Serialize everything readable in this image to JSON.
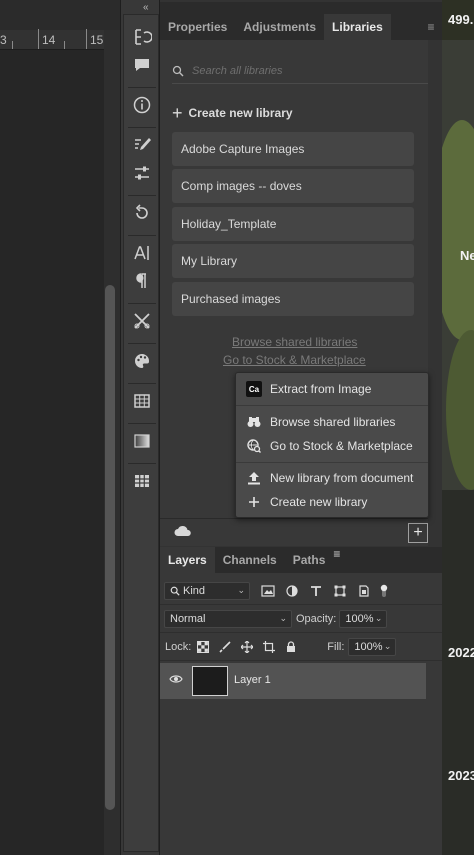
{
  "ruler": {
    "labels": [
      "3",
      "14",
      "15"
    ]
  },
  "properties_panel": {
    "tabs": [
      "Properties",
      "Adjustments",
      "Libraries"
    ],
    "active_tab": "Libraries"
  },
  "libraries": {
    "search_placeholder": "Search all libraries",
    "create_new_label": "Create new library",
    "items": [
      "Adobe Capture Images",
      "Comp images -- doves",
      "Holiday_Template",
      "My Library",
      "Purchased images"
    ],
    "browse_shared_link": "Browse shared libraries",
    "stock_link": "Go to Stock & Marketplace"
  },
  "popup_menu": {
    "ca_badge": "Ca",
    "items": [
      "Extract from Image",
      "Browse shared libraries",
      "Go to Stock & Marketplace",
      "New library from document",
      "Create new library"
    ]
  },
  "layers_panel": {
    "tabs": [
      "Layers",
      "Channels",
      "Paths"
    ],
    "active_tab": "Layers",
    "filter_kind": "Kind",
    "blend_mode": "Normal",
    "opacity_label": "Opacity:",
    "opacity_value": "100%",
    "lock_label": "Lock:",
    "fill_label": "Fill:",
    "fill_value": "100%",
    "layers": [
      {
        "name": "Layer 1",
        "visible": true
      }
    ]
  },
  "photo_strip": {
    "texts": [
      "499.",
      "Ne",
      "2022",
      "2023"
    ]
  },
  "colors": {
    "panel_bg": "#383838",
    "tab_bar_bg": "#2b2b2b",
    "item_bg": "#454545",
    "popup_bg": "#4a4a4a",
    "selected_layer": "#535353"
  }
}
